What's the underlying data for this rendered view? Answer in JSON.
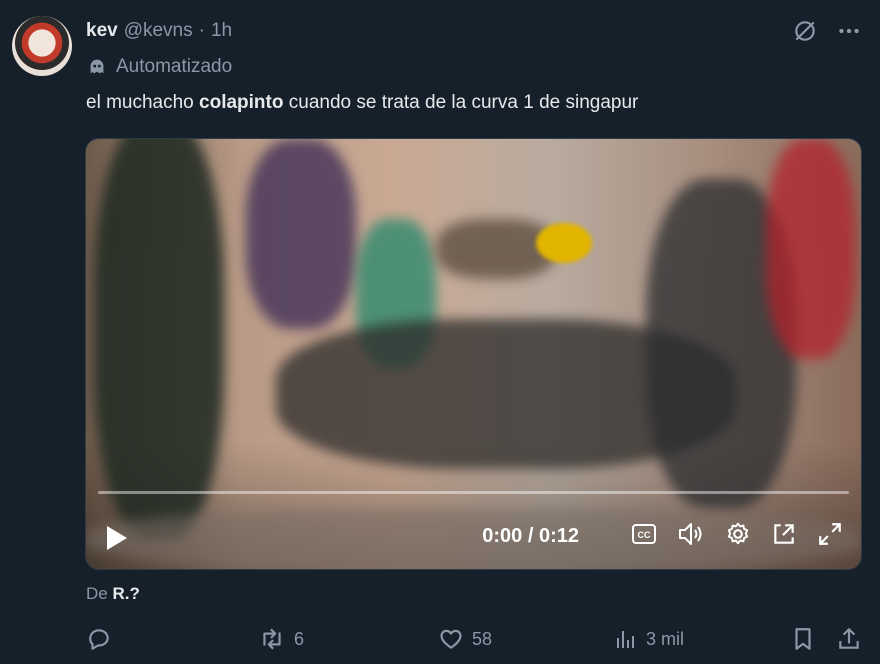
{
  "author": {
    "name": "kev",
    "handle": "@kevns",
    "separator": "·",
    "time": "1h"
  },
  "automated_label": "Automatizado",
  "tweet": {
    "text_before": "el muchacho ",
    "text_bold": "colapinto",
    "text_after": " cuando se trata de la curva 1 de singapur"
  },
  "video": {
    "time_readout": "0:00 / 0:12",
    "progress": 0.0
  },
  "source": {
    "prefix": "De",
    "name": "R.?"
  },
  "actions": {
    "retweets": "6",
    "likes": "58",
    "views": "3 mil"
  },
  "colors": {
    "background": "#15202b",
    "text": "#e7e9ea",
    "muted": "#8b98a5"
  },
  "icons": [
    "grok-icon",
    "more-icon",
    "bot-icon",
    "play-icon",
    "captions-icon",
    "volume-icon",
    "settings-icon",
    "popout-icon",
    "fullscreen-icon",
    "reply-icon",
    "retweet-icon",
    "like-icon",
    "views-icon",
    "bookmark-icon",
    "share-icon"
  ]
}
